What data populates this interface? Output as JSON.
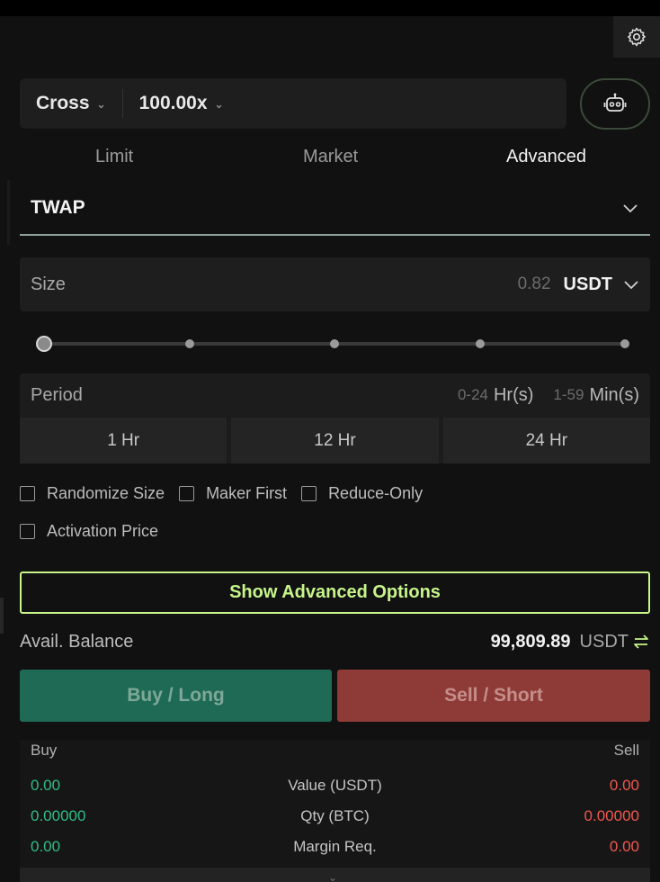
{
  "header": {
    "settings_icon": "gear-icon"
  },
  "leverage": {
    "margin_mode": "Cross",
    "leverage_value": "100.00x",
    "bot_icon": "robot-icon"
  },
  "order_tabs": [
    {
      "label": "Limit",
      "active": false
    },
    {
      "label": "Market",
      "active": false
    },
    {
      "label": "Advanced",
      "active": true
    }
  ],
  "strategy": {
    "selected": "TWAP"
  },
  "size": {
    "label": "Size",
    "value": "0.82",
    "unit": "USDT"
  },
  "slider": {
    "value_fraction": 0.0,
    "stops": 5
  },
  "period": {
    "label": "Period",
    "hours_range": "0-24",
    "hours_unit": "Hr(s)",
    "minutes_range": "1-59",
    "minutes_unit": "Min(s)",
    "presets": [
      "1 Hr",
      "12 Hr",
      "24 Hr"
    ]
  },
  "options": {
    "randomize_size": "Randomize Size",
    "maker_first": "Maker First",
    "reduce_only": "Reduce-Only",
    "activation_price": "Activation Price"
  },
  "advanced_button": "Show Advanced Options",
  "balance": {
    "label": "Avail. Balance",
    "amount": "99,809.89",
    "currency": "USDT"
  },
  "actions": {
    "buy_label": "Buy / Long",
    "sell_label": "Sell / Short"
  },
  "summary": {
    "buy_header": "Buy",
    "sell_header": "Sell",
    "rows": [
      {
        "buy": "0.00",
        "label": "Value (USDT)",
        "sell": "0.00"
      },
      {
        "buy": "0.00000",
        "label": "Qty (BTC)",
        "sell": "0.00000"
      },
      {
        "buy": "0.00",
        "label": "Margin Req.",
        "sell": "0.00"
      }
    ]
  },
  "colors": {
    "accent": "#c7f58a",
    "buy": "#1e6a55",
    "sell": "#8e3a37",
    "positive_text": "#2fbd85",
    "negative_text": "#f0574f"
  }
}
